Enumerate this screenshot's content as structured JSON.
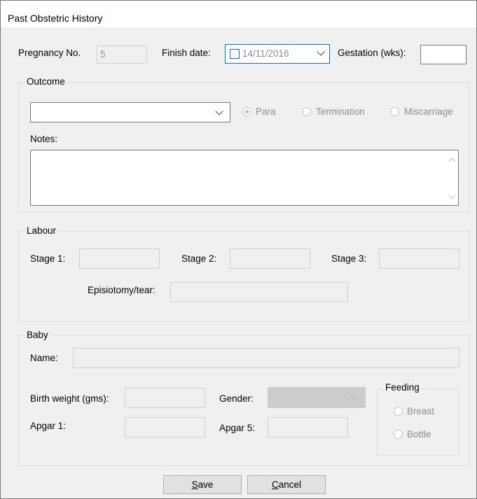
{
  "window": {
    "title": "Past Obstetric History"
  },
  "pregnancy": {
    "label": "Pregnancy No.",
    "value": "5"
  },
  "finish_date": {
    "label": "Finish date:",
    "value": "14/11/2016"
  },
  "gestation": {
    "label": "Gestation (wks):",
    "value": ""
  },
  "outcome": {
    "legend": "Outcome",
    "select_value": "",
    "radios": [
      {
        "label": "Para",
        "selected": true
      },
      {
        "label": "Termination",
        "selected": false
      },
      {
        "label": "Miscarriage",
        "selected": false
      }
    ],
    "notes_label": "Notes:",
    "notes_value": ""
  },
  "labour": {
    "legend": "Labour",
    "stage1_label": "Stage 1:",
    "stage2_label": "Stage 2:",
    "stage3_label": "Stage 3:",
    "episiotomy_label": "Episiotomy/tear:"
  },
  "baby": {
    "legend": "Baby",
    "name_label": "Name:",
    "weight_label": "Birth weight (gms):",
    "gender_label": "Gender:",
    "apgar1_label": "Apgar 1:",
    "apgar5_label": "Apgar 5:",
    "feeding": {
      "legend": "Feeding",
      "options": [
        "Breast",
        "Bottle"
      ]
    }
  },
  "buttons": {
    "save_rest": "ave",
    "save_key": "S",
    "cancel_rest": "ancel",
    "cancel_key": "C"
  }
}
